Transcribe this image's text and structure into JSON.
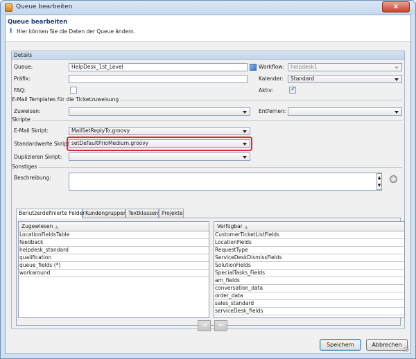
{
  "window": {
    "title": "Queue bearbeiten",
    "close_label": "x"
  },
  "header": {
    "title": "Queue bearbeiten",
    "info_icon": "i",
    "description": "Hier können Sie die Daten der Queue ändern."
  },
  "details": {
    "section_label": "Details",
    "queue": {
      "label": "Queue:",
      "value": "HelpDesk_1st_Level"
    },
    "workflow": {
      "label": "Workflow:",
      "value": "helpdesk1"
    },
    "praefix": {
      "label": "Präfix:",
      "value": ""
    },
    "kalender": {
      "label": "Kalender:",
      "value": "Standard"
    },
    "faq": {
      "label": "FAQ:",
      "checked": false
    },
    "aktiv": {
      "label": "Aktiv:",
      "checked": true
    }
  },
  "email_templates": {
    "section_label": "E-Mail Templates für die Ticketzuweisung",
    "zuweisen": {
      "label": "Zuweisen:",
      "value": ""
    },
    "entfernen": {
      "label": "Entfernen:",
      "value": ""
    }
  },
  "skripte": {
    "section_label": "Skripte",
    "email_skript": {
      "label": "E-Mail Skript:",
      "value": "MailSetReplyTo.groovy"
    },
    "standardwerte_skript": {
      "label": "Standardwerte Skript:",
      "value": "setDefaultPrioMedium.groovy"
    },
    "duplizieren_skript": {
      "label": "Duplizieren Skript:",
      "value": ""
    }
  },
  "sonstiges": {
    "section_label": "Sonstiges",
    "beschreibung": {
      "label": "Beschreibung:",
      "value": ""
    },
    "spin_up": "▲",
    "spin_down": "▼"
  },
  "tabs": [
    {
      "label": "Benutzerdefinierte Felder",
      "active": true
    },
    {
      "label": "Kundengruppen",
      "active": false
    },
    {
      "label": "Textklassen",
      "active": false
    },
    {
      "label": "Projekte",
      "active": false
    }
  ],
  "assigned_list": {
    "header": "Zugewiesen",
    "sort_glyph": "▲",
    "items": [
      "LocationFieldsTable",
      "feedback",
      "helpdesk_standard",
      "qualification",
      "queue_fields (*)",
      "workaround"
    ]
  },
  "available_list": {
    "header": "Verfügbar",
    "sort_glyph": "▲",
    "items": [
      "CustomerTicketListFields",
      "LocationFields",
      "RequestType",
      "ServiceDeskDismissFields",
      "SolutionFields",
      "SpecialTasks_Fields",
      "am_fields",
      "conversation_data",
      "order_data",
      "sales_standard",
      "serviceDesk_fields"
    ]
  },
  "move_buttons": {
    "move_right": "➜",
    "move_left": "➜"
  },
  "footer": {
    "save_label": "Speichern",
    "cancel_label": "Abbrechen"
  },
  "colors": {
    "highlight": "#d62b2b",
    "accent": "#1a3d7a"
  }
}
